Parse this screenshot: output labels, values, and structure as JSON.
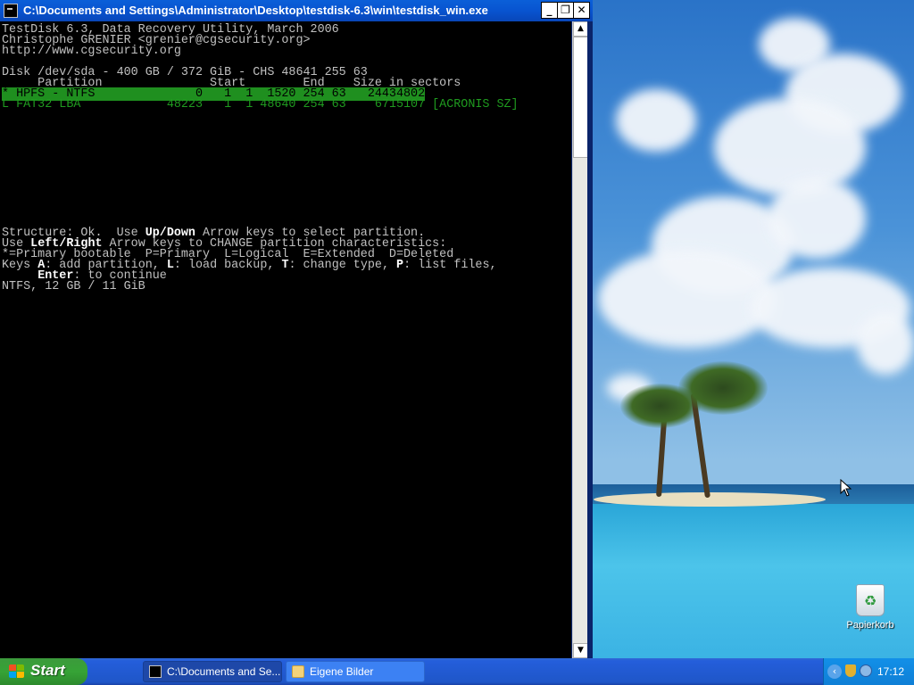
{
  "window": {
    "title": "C:\\Documents and Settings\\Administrator\\Desktop\\testdisk-6.3\\win\\testdisk_win.exe"
  },
  "console": {
    "line1": "TestDisk 6.3, Data Recovery Utility, March 2006",
    "line2": "Christophe GRENIER <grenier@cgsecurity.org>",
    "line3": "http://www.cgsecurity.org",
    "disk_line": "Disk /dev/sda - 400 GB / 372 GiB - CHS 48641 255 63",
    "header_line": "     Partition               Start        End    Size in sectors",
    "partitions": [
      {
        "text": "* HPFS - NTFS              0   1  1  1520 254 63   24434802",
        "selected": true
      },
      {
        "text": "L FAT32 LBA            48223   1  1 48640 254 63    6715107 [ACRONIS SZ]",
        "selected": false
      }
    ],
    "help": {
      "l1_a": "Structure: Ok.  Use ",
      "l1_b": "Up/Down",
      "l1_c": " Arrow keys to select partition.",
      "l2_a": "Use ",
      "l2_b": "Left/Right",
      "l2_c": " Arrow keys to CHANGE partition characteristics:",
      "l3": "*=Primary bootable  P=Primary  L=Logical  E=Extended  D=Deleted",
      "l4_a": "Keys ",
      "l4_b": "A",
      "l4_c": ": add partition, ",
      "l4_d": "L",
      "l4_e": ": load backup, ",
      "l4_f": "T",
      "l4_g": ": change type, ",
      "l4_h": "P",
      "l4_i": ": list files,",
      "l5_a": "     ",
      "l5_b": "Enter",
      "l5_c": ": to continue",
      "l6": "NTFS, 12 GB / 11 GiB"
    }
  },
  "desktop": {
    "recycle_bin_label": "Papierkorb"
  },
  "taskbar": {
    "start_label": "Start",
    "tasks": [
      {
        "label": "C:\\Documents and Se...",
        "active": true
      },
      {
        "label": "Eigene Bilder",
        "active": false
      }
    ],
    "tray_chevron": "‹",
    "clock": "17:12"
  }
}
